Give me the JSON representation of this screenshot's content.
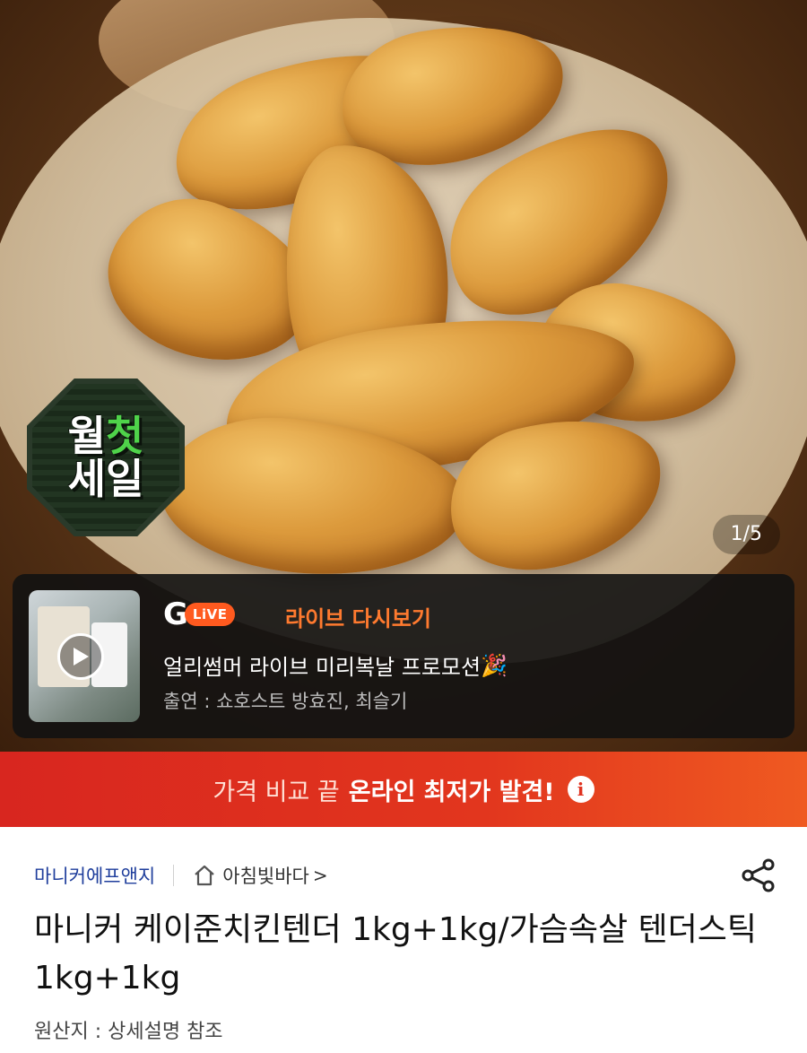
{
  "hero": {
    "badge_line1_a": "월",
    "badge_line1_b": "첫",
    "badge_line2": "세일",
    "counter": "1/5"
  },
  "live": {
    "logo_g": "G",
    "logo_pill": "LiVE",
    "label": "라이브 다시보기",
    "title": "얼리썸머 라이브 미리복날 프로모션",
    "title_emoji": "🎉",
    "cast": "출연 : 쇼호스트 방효진, 최슬기"
  },
  "promo": {
    "prefix": "가격 비교 끝",
    "highlight": "온라인 최저가 발견!",
    "info_glyph": "i"
  },
  "product": {
    "seller": "마니커에프앤지",
    "store": "아침빛바다",
    "store_chevron": ">",
    "title": "마니커 케이준치킨텐더 1kg+1kg/가슴속살 텐더스틱 1kg+1kg",
    "origin": "원산지 : 상세설명 참조"
  },
  "icons": {
    "play": "play-icon",
    "home": "home-icon",
    "share": "share-icon",
    "info": "info-icon"
  },
  "colors": {
    "promo_bg": "#e0321f",
    "live_accent": "#ff5a1f",
    "seller_link": "#1f3e9c"
  }
}
